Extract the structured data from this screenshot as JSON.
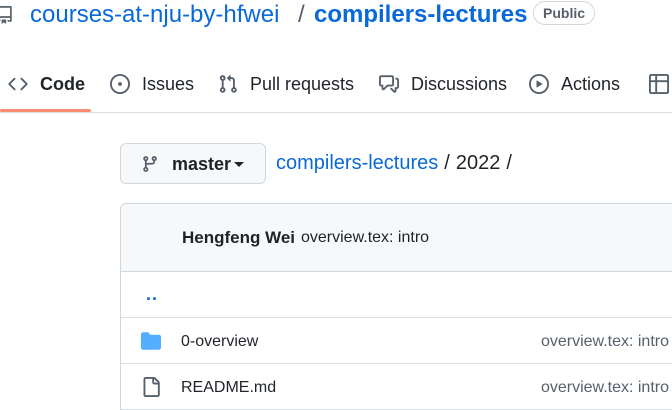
{
  "repo": {
    "owner": "courses-at-nju-by-hfwei",
    "separator": "/",
    "name": "compilers-lectures",
    "visibility": "Public"
  },
  "tabs": [
    {
      "label": "Code",
      "icon": "code-icon",
      "active": true
    },
    {
      "label": "Issues",
      "icon": "issue-icon",
      "active": false
    },
    {
      "label": "Pull requests",
      "icon": "pull-request-icon",
      "active": false
    },
    {
      "label": "Discussions",
      "icon": "discussion-icon",
      "active": false
    },
    {
      "label": "Actions",
      "icon": "play-icon",
      "active": false
    },
    {
      "label": "",
      "icon": "table-icon",
      "active": false
    }
  ],
  "branch": {
    "label": "master"
  },
  "breadcrumb": {
    "root": "compilers-lectures",
    "separator": "/",
    "current": "2022",
    "trailing": "/"
  },
  "latest_commit": {
    "author": "Hengfeng Wei",
    "message": "overview.tex: intro"
  },
  "parent_dir": "..",
  "files": [
    {
      "type": "directory",
      "name": "0-overview",
      "commit": "overview.tex: intro"
    },
    {
      "type": "file",
      "name": "README.md",
      "commit": "overview.tex: intro"
    }
  ],
  "colors": {
    "link": "#0969da",
    "folder": "#54aeff",
    "active_tab_underline": "#fd8c73",
    "text": "#1f2328",
    "muted": "#57606a"
  }
}
